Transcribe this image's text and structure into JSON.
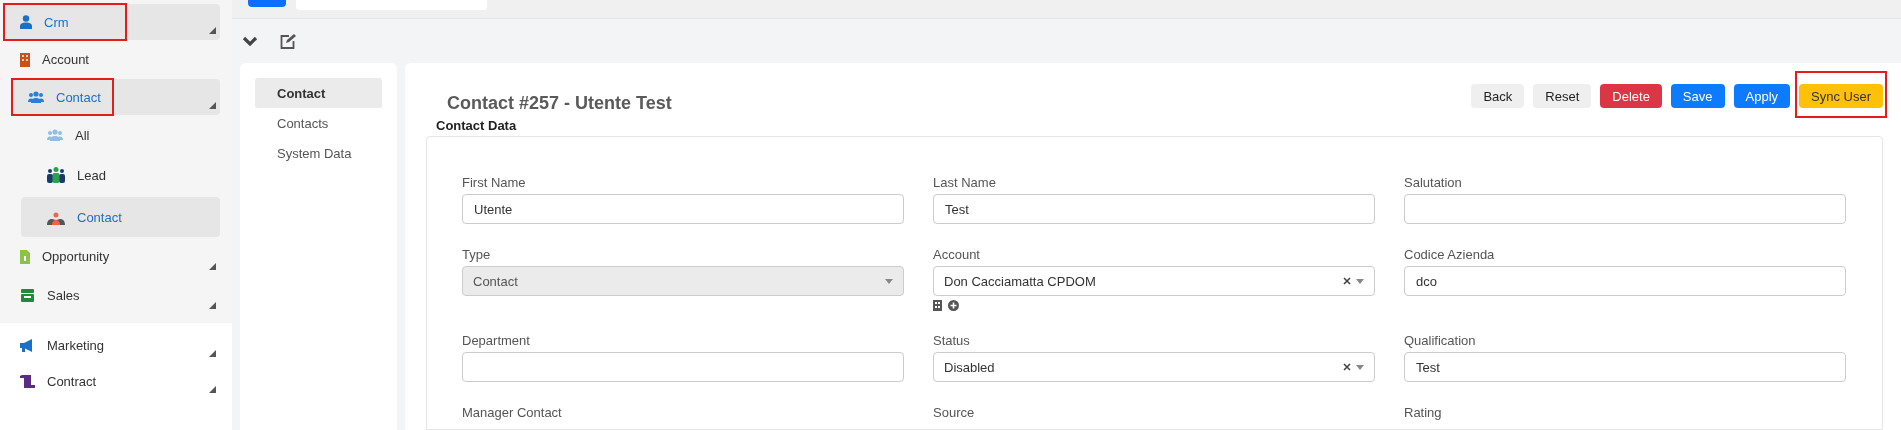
{
  "sidebar": {
    "items": [
      {
        "label": "Crm",
        "expanded": true,
        "highlighted": true,
        "children": [
          {
            "label": "Account",
            "selected": false
          },
          {
            "label": "Contact",
            "expanded": true,
            "highlighted": true,
            "children": [
              {
                "label": "All",
                "selected": false
              },
              {
                "label": "Lead",
                "selected": false
              },
              {
                "label": "Contact",
                "selected": true
              }
            ]
          },
          {
            "label": "Opportunity",
            "expanded": false
          },
          {
            "label": "Sales",
            "expanded": false
          }
        ]
      },
      {
        "label": "Marketing",
        "expanded": false
      },
      {
        "label": "Contract",
        "expanded": false
      }
    ]
  },
  "section_tabs": [
    {
      "label": "Contact",
      "selected": true
    },
    {
      "label": "Contacts",
      "selected": false
    },
    {
      "label": "System Data",
      "selected": false
    }
  ],
  "record": {
    "title": "Contact #257 - Utente Test",
    "buttons": [
      {
        "label": "Back",
        "kind": "light",
        "highlighted": false
      },
      {
        "label": "Reset",
        "kind": "light",
        "highlighted": false
      },
      {
        "label": "Delete",
        "kind": "danger",
        "highlighted": false
      },
      {
        "label": "Save",
        "kind": "primary",
        "highlighted": false
      },
      {
        "label": "Apply",
        "kind": "primary",
        "highlighted": false
      },
      {
        "label": "Sync User",
        "kind": "warning",
        "highlighted": true
      }
    ],
    "section": "Contact Data",
    "fields": [
      {
        "label": "First Name",
        "kind": "text",
        "value": "Utente"
      },
      {
        "label": "Last Name",
        "kind": "text",
        "value": "Test"
      },
      {
        "label": "Salutation",
        "kind": "text"
      },
      {
        "label": "Type",
        "kind": "select",
        "value": "Contact",
        "disabled": true,
        "clearable": false
      },
      {
        "label": "Account",
        "kind": "select",
        "value": "Don Cacciamatta CPDOM",
        "disabled": false,
        "clearable": true,
        "actions": true
      },
      {
        "label": "Codice Azienda",
        "kind": "text",
        "value": "dco"
      },
      {
        "label": "Department",
        "kind": "text"
      },
      {
        "label": "Status",
        "kind": "select",
        "value": "Disabled",
        "disabled": false,
        "clearable": true
      },
      {
        "label": "Qualification",
        "kind": "text",
        "value": "Test"
      },
      {
        "label": "Manager Contact",
        "kind": "label"
      },
      {
        "label": "Source",
        "kind": "label"
      },
      {
        "label": "Rating",
        "kind": "label"
      }
    ]
  }
}
